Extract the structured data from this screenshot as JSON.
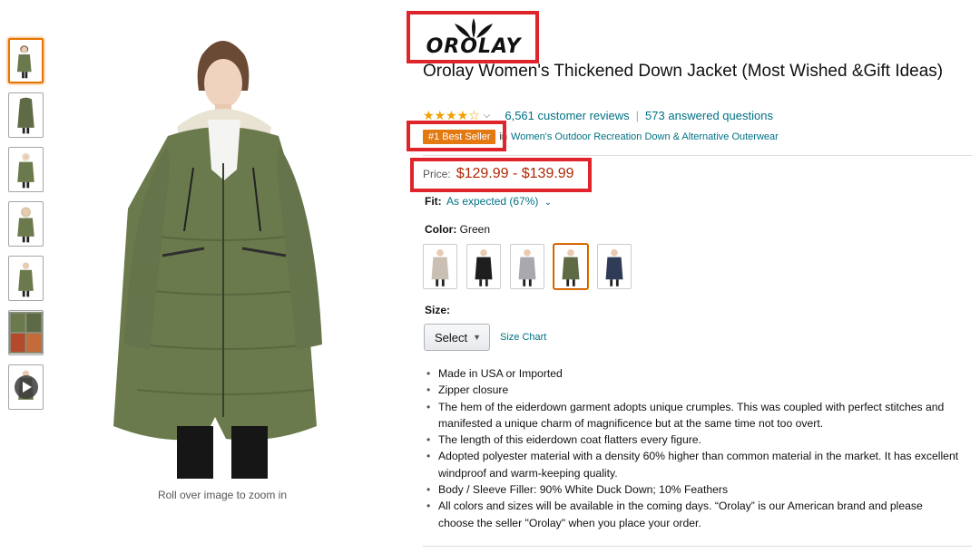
{
  "brand": {
    "logo_text": "OROLAY"
  },
  "product": {
    "title": "Orolay Women's Thickened Down Jacket (Most Wished &Gift Ideas)",
    "rating_stars": "★★★★☆",
    "reviews_link": "6,561 customer reviews",
    "questions_link": "573 answered questions",
    "best_seller_badge": "#1 Best Seller",
    "best_seller_in": "in",
    "best_seller_category": "Women's Outdoor Recreation Down & Alternative Outerwear",
    "price_label": "Price:",
    "price_value": "$129.99 - $139.99",
    "fit_label": "Fit:",
    "fit_value": "As expected (67%)",
    "color_label": "Color:",
    "color_value": "Green",
    "size_label": "Size:",
    "size_select": "Select",
    "size_chart": "Size Chart",
    "zoom_hint": "Roll over image to zoom in",
    "bullets": [
      "Made in USA or Imported",
      "Zipper closure",
      "The hem of the eiderdown garment adopts unique crumples. This was coupled with perfect stitches and manifested a unique charm of magnificence but at the same time not too overt.",
      "The length of this eiderdown coat flatters every figure.",
      "Adopted polyester material with a density 60% higher than common material in the market. It has excellent windproof and warm-keeping quality.",
      "Body / Sleeve Filler: 90% White Duck Down; 10% Feathers",
      "All colors and sizes will be available in the coming days. “Orolay” is our American brand and please choose the seller \"Orolay\" when you place your order."
    ]
  },
  "swatch_colors": [
    "#c9bfb3",
    "#1e1e1e",
    "#a9a9ad",
    "#5f6b45",
    "#2f3b57"
  ],
  "colors": {
    "accent_orange": "#e47911",
    "price_red": "#b12704",
    "link": "#007185",
    "highlight_box": "#e0242b",
    "jacket_green": "#6b7a4c"
  }
}
